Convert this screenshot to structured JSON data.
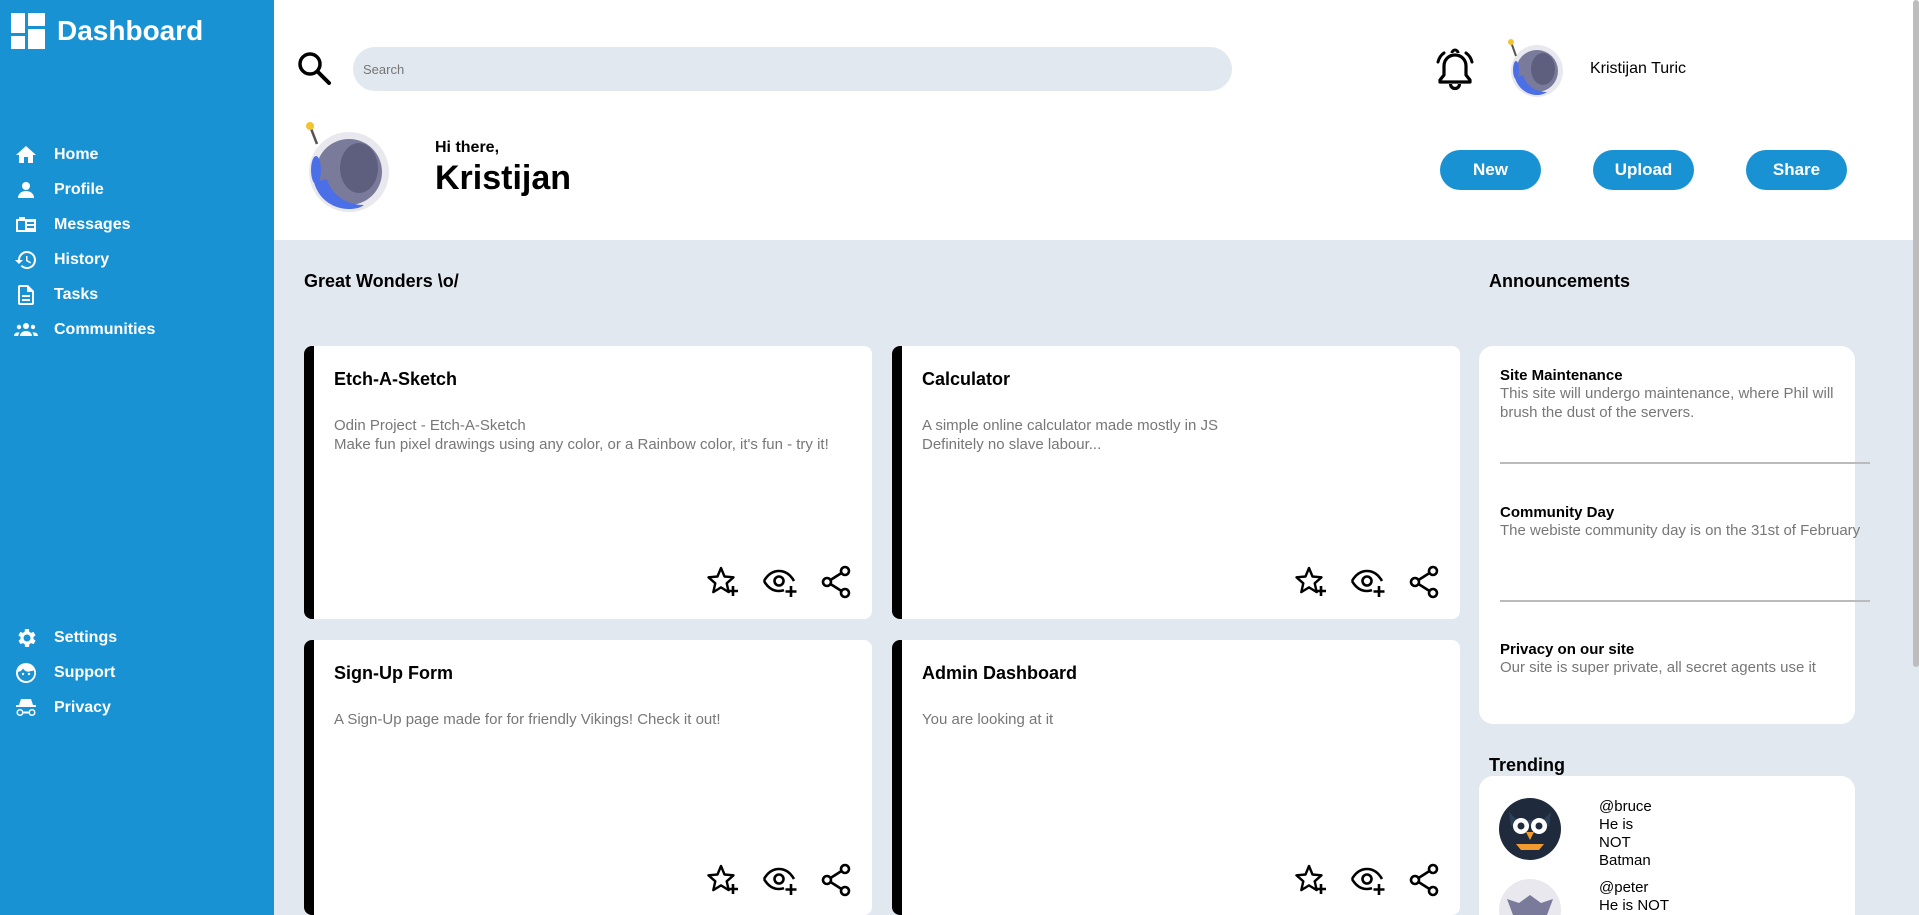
{
  "sidebar": {
    "brand": "Dashboard",
    "main_items": [
      {
        "label": "Home",
        "icon": "home-icon"
      },
      {
        "label": "Profile",
        "icon": "profile-icon"
      },
      {
        "label": "Messages",
        "icon": "messages-icon"
      },
      {
        "label": "History",
        "icon": "history-icon"
      },
      {
        "label": "Tasks",
        "icon": "tasks-icon"
      },
      {
        "label": "Communities",
        "icon": "communities-icon"
      }
    ],
    "bottom_items": [
      {
        "label": "Settings",
        "icon": "settings-icon"
      },
      {
        "label": "Support",
        "icon": "support-icon"
      },
      {
        "label": "Privacy",
        "icon": "privacy-icon"
      }
    ]
  },
  "header": {
    "search_placeholder": "Search",
    "user_name": "Kristijan Turic",
    "greeting": "Hi there,",
    "greeting_name": "Kristijan",
    "buttons": {
      "new": "New",
      "upload": "Upload",
      "share": "Share"
    }
  },
  "projects": {
    "title": "Great Wonders \\o/",
    "cards": [
      {
        "title": "Etch-A-Sketch",
        "lines": [
          "Odin Project - Etch-A-Sketch",
          "Make fun pixel drawings using any color, or a Rainbow color, it's fun - try it!"
        ]
      },
      {
        "title": "Calculator",
        "lines": [
          "A simple online calculator made mostly in JS",
          "Definitely no slave labour..."
        ]
      },
      {
        "title": "Sign-Up Form",
        "lines": [
          "A Sign-Up page made for for friendly Vikings! Check it out!"
        ]
      },
      {
        "title": "Admin Dashboard",
        "lines": [
          "You are looking at it"
        ]
      }
    ]
  },
  "announcements": {
    "title": "Announcements",
    "items": [
      {
        "title": "Site Maintenance",
        "text": "This site will undergo maintenance, where Phil will brush the dust of the servers."
      },
      {
        "title": "Community Day",
        "text": "The webiste community day is on the 31st of February"
      },
      {
        "title": "Privacy on our site",
        "text": "Our site is super private, all secret agents use it"
      }
    ]
  },
  "trending": {
    "title": "Trending",
    "items": [
      {
        "handle": "@bruce",
        "text": "He is NOT Batman"
      },
      {
        "handle": "@peter",
        "text": "He is NOT Spiderman"
      }
    ]
  },
  "colors": {
    "accent": "#1992d4",
    "background": "#e2e8f0",
    "card_border": "#000000"
  }
}
